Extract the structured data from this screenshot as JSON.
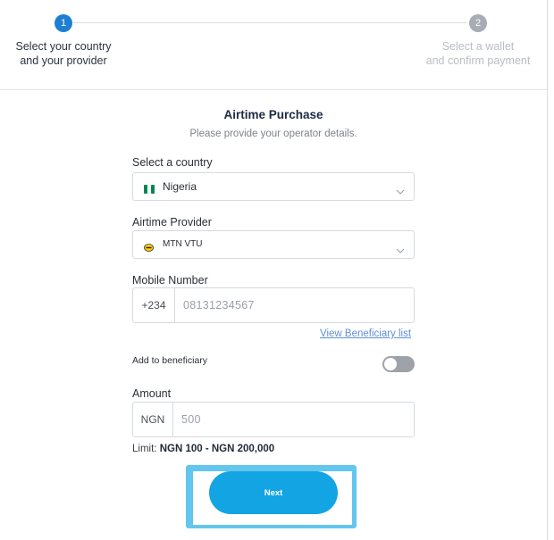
{
  "stepper": {
    "step1": {
      "number": "1",
      "line1": "Select your country",
      "line2": "and your provider"
    },
    "step2": {
      "number": "2",
      "line1": "Select a wallet",
      "line2": "and confirm payment"
    }
  },
  "form": {
    "title": "Airtime Purchase",
    "subtitle": "Please provide your operator details.",
    "country": {
      "label": "Select a country",
      "value": "Nigeria"
    },
    "provider": {
      "label": "Airtime Provider",
      "value": "MTN VTU"
    },
    "mobile": {
      "label": "Mobile Number",
      "prefix": "+234",
      "placeholder": "08131234567"
    },
    "beneficiary_link": "View Beneficiary list",
    "add_beneficiary": {
      "label": "Add to beneficiary",
      "enabled": false
    },
    "amount": {
      "label": "Amount",
      "prefix": "NGN",
      "placeholder": "500"
    },
    "limit": {
      "prefix": "Limit:",
      "range": "NGN 100 - NGN 200,000"
    },
    "next_label": "Next"
  },
  "colors": {
    "primary": "#1e7fd2",
    "button": "#13a4e4",
    "highlight": "#62c6ee",
    "nigeria_green": "#008751",
    "mtn_yellow": "#ffcc00"
  }
}
